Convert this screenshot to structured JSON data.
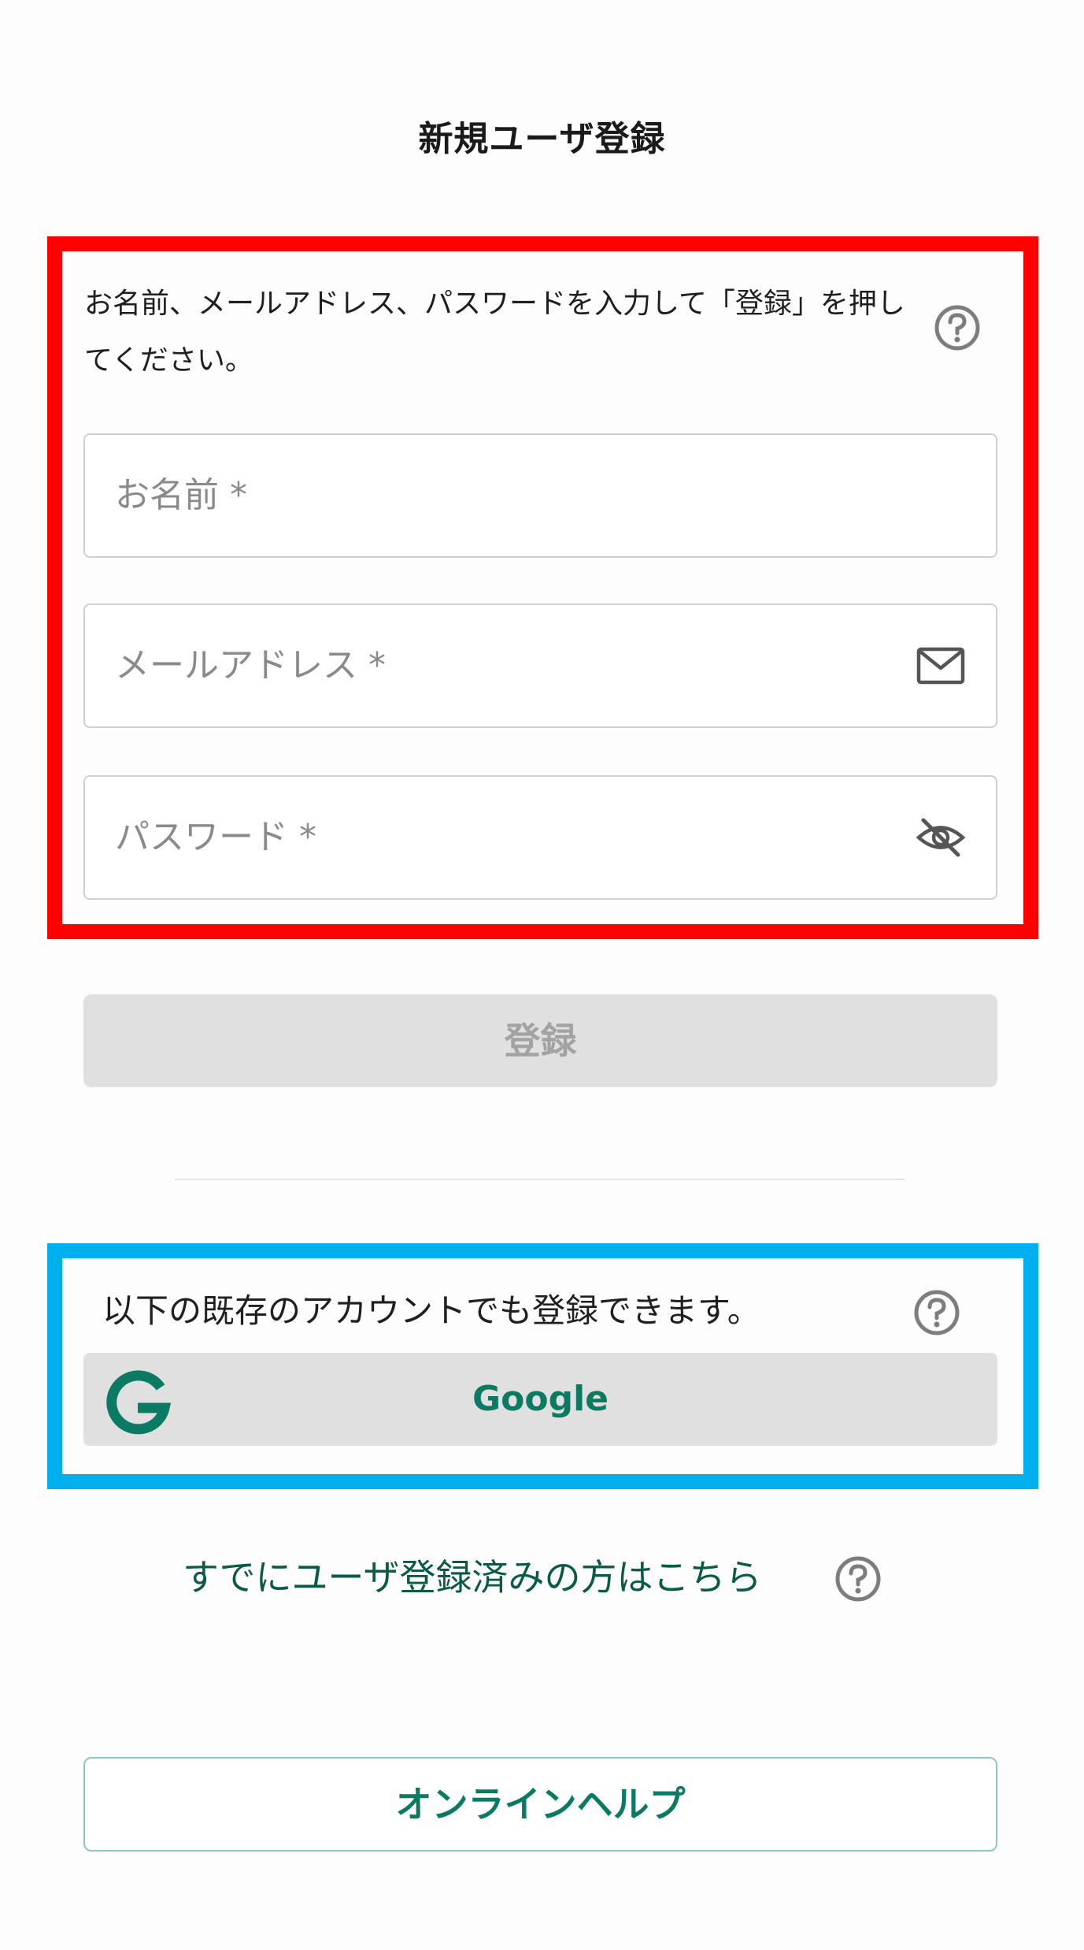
{
  "page": {
    "title": "新規ユーザ登録"
  },
  "form": {
    "instructions": "お名前、メールアドレス、パスワードを入力して「登録」を押してください。",
    "name_placeholder": "お名前 *",
    "email_placeholder": "メールアドレス *",
    "password_placeholder": "パスワード *",
    "register_label": "登録"
  },
  "social": {
    "text": "以下の既存のアカウントでも登録できます。",
    "google_label": "Google"
  },
  "footer": {
    "login_link": "すでにユーザ登録済みの方はこちら",
    "online_help_label": "オンラインヘルプ"
  },
  "icons": {
    "help": "question-circle-icon",
    "email": "envelope-icon",
    "password": "eye-slash-icon",
    "google": "google-g-icon"
  },
  "colors": {
    "accent": "#0b7a63",
    "highlight_red": "#ff0000",
    "highlight_blue": "#00b0ee",
    "disabled_button": "#e0e0e0"
  }
}
